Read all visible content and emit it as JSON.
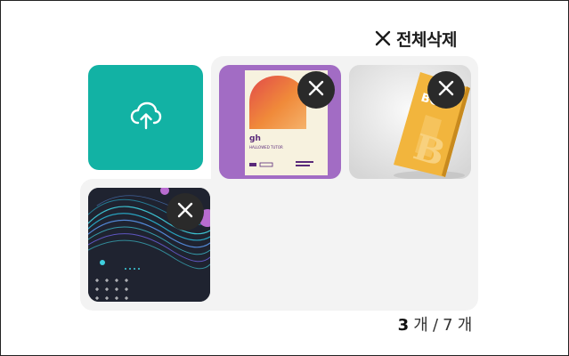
{
  "toolbar": {
    "clear_all_label": "전체삭제"
  },
  "upload": {
    "icon": "cloud-upload-icon",
    "color": "#12b2a4"
  },
  "thumbnails": [
    {
      "name": "thumb-poster",
      "poster_title": "gh",
      "poster_subtitle": "HALLOWED TUTOR",
      "accent": "#a26cc4"
    },
    {
      "name": "thumb-book",
      "book_letter": "B",
      "book_cover_text": "BO",
      "accent": "#f2b53d"
    },
    {
      "name": "thumb-wave",
      "accent": "#1f2330"
    }
  ],
  "counter": {
    "current": "3",
    "unit1": " 개 / ",
    "max": "7",
    "unit2": " 개"
  },
  "colors": {
    "panel": "#f3f3f3",
    "remove_button": "#2a2a2a"
  }
}
